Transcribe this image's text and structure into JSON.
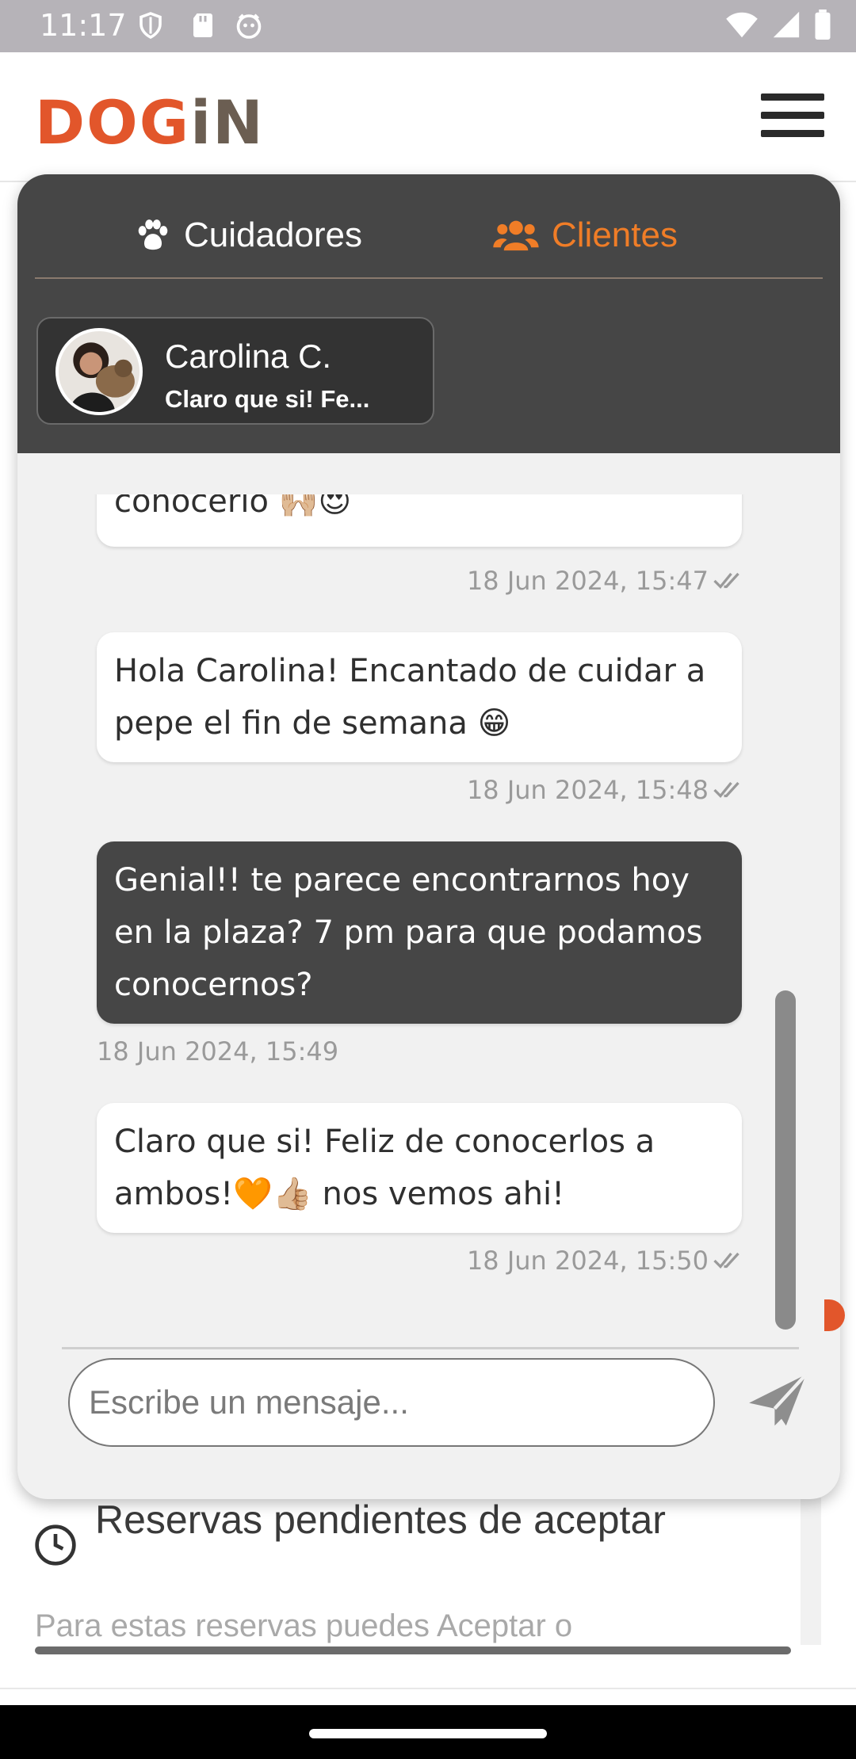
{
  "status_bar": {
    "time": "11:17"
  },
  "header": {
    "logo_parts": [
      "D",
      "O",
      "G",
      "i",
      "N"
    ]
  },
  "chat": {
    "tabs": [
      {
        "label": "Cuidadores",
        "icon": "paw-icon",
        "active": false
      },
      {
        "label": "Clientes",
        "icon": "users-icon",
        "active": true
      }
    ],
    "contact": {
      "name": "Carolina C.",
      "preview": "Claro que si! Fe..."
    },
    "messages": [
      {
        "text": "conocerlo 🙌🏼😍",
        "time": "18 Jun 2024, 15:47",
        "from": "client"
      },
      {
        "text": "Hola Carolina! Encantado de cuidar a pepe el fin de semana 😁",
        "time": "18 Jun 2024, 15:48",
        "from": "client"
      },
      {
        "text": "Genial!! te parece encontrarnos hoy en la plaza? 7 pm para que podamos conocernos?",
        "time": "18 Jun 2024, 15:49",
        "from": "me"
      },
      {
        "text": "Claro que si! Feliz de conocerlos a ambos!🧡👍🏼 nos vemos ahi!",
        "time": "18 Jun 2024, 15:50",
        "from": "client"
      }
    ],
    "input_placeholder": "Escribe un mensaje..."
  },
  "background_page": {
    "section_title": "Reservas pendientes de aceptar",
    "section_subtitle": "Para estas reservas puedes Aceptar o"
  },
  "colors": {
    "accent": "#f07d27",
    "logo_orange": "#e2562b",
    "panel_dark": "#464646"
  }
}
